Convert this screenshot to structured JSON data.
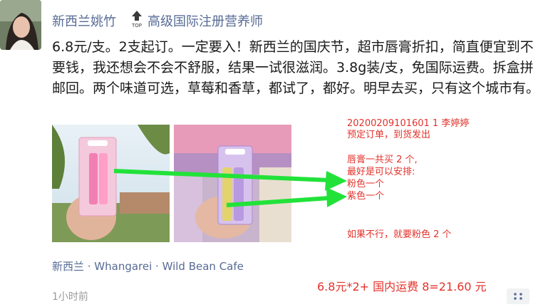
{
  "post": {
    "author_name": "新西兰姚竹",
    "top_badge": "TOP",
    "author_title": "高级国际注册营养师",
    "text": "6.8元/支。2支起订。一定要入！新西兰的国庆节，超市唇膏折扣，简直便宜到不要钱，我还想会不会不舒服，结果一试很滋润。3.8g装/支，免国际运费。拆盒拼邮回。两个味道可选，草莓和香草，都试了，都好。明早去买，只有这个城市有。",
    "location": "新西兰 · Whangarei · Wild Bean Cafe",
    "time_ago": "1小时前",
    "photos": [
      {
        "label": "strawberry-lip-balm-photo"
      },
      {
        "label": "vanilla-lip-balm-photo"
      }
    ]
  },
  "annotations": {
    "order_id": "20200209101601 1   李婷婷",
    "order_status": "预定订单，到货发出",
    "qty_note": "唇膏一共买 2 个,",
    "arrange_note": "最好是可以安排:",
    "pink_line": "粉色一个",
    "purple_line": "紫色一个",
    "fallback_note": "如果不行，就要粉色 2 个",
    "price_calc": "6.8元*2+ 国内运费 8=21.60 元",
    "text_color": "#e3322b",
    "arrow_color": "#22e23a"
  },
  "icons": {
    "more": "more-dots-icon",
    "top": "top-arrow-icon"
  },
  "colors": {
    "link": "#576b95",
    "body_text": "#1a1a1a",
    "meta_text": "#9a9a9a"
  }
}
